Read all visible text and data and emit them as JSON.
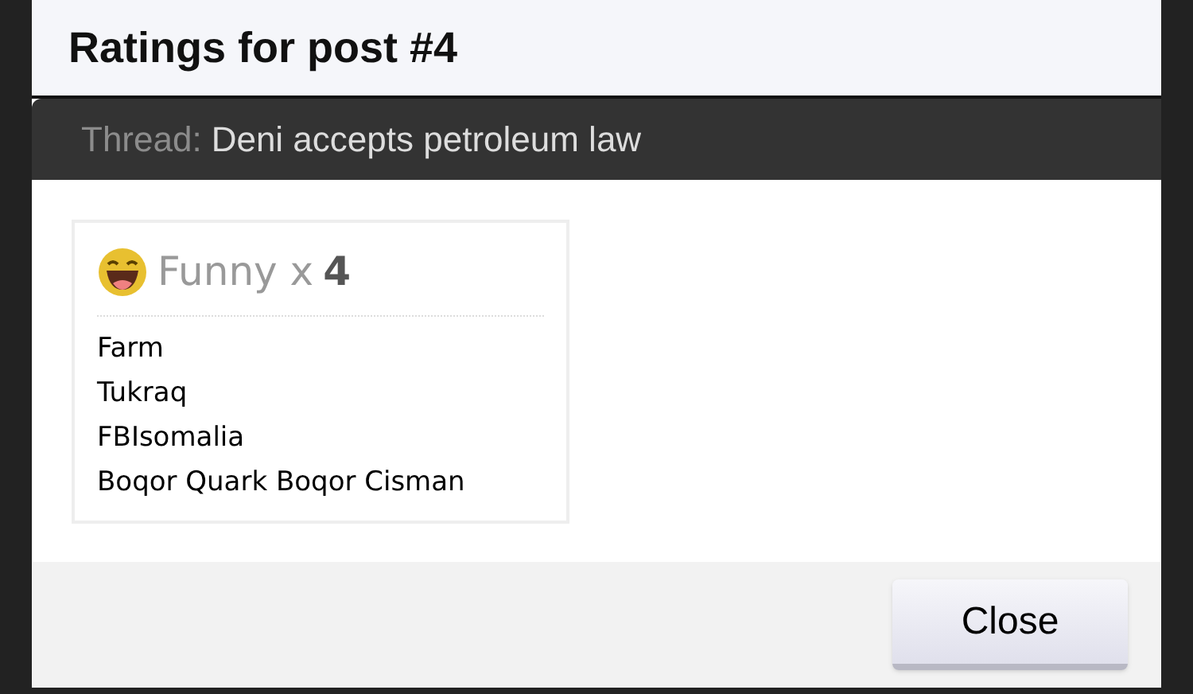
{
  "dialog": {
    "title": "Ratings for post #4"
  },
  "thread": {
    "label": "Thread:",
    "title": "Deni accepts petroleum law"
  },
  "ratings": [
    {
      "name": "Funny x",
      "count": "4",
      "users": [
        "Farm",
        "Tukraq",
        "FBIsomalia",
        "Boqor Quark Boqor Cisman"
      ]
    }
  ],
  "buttons": [
    "Close"
  ]
}
